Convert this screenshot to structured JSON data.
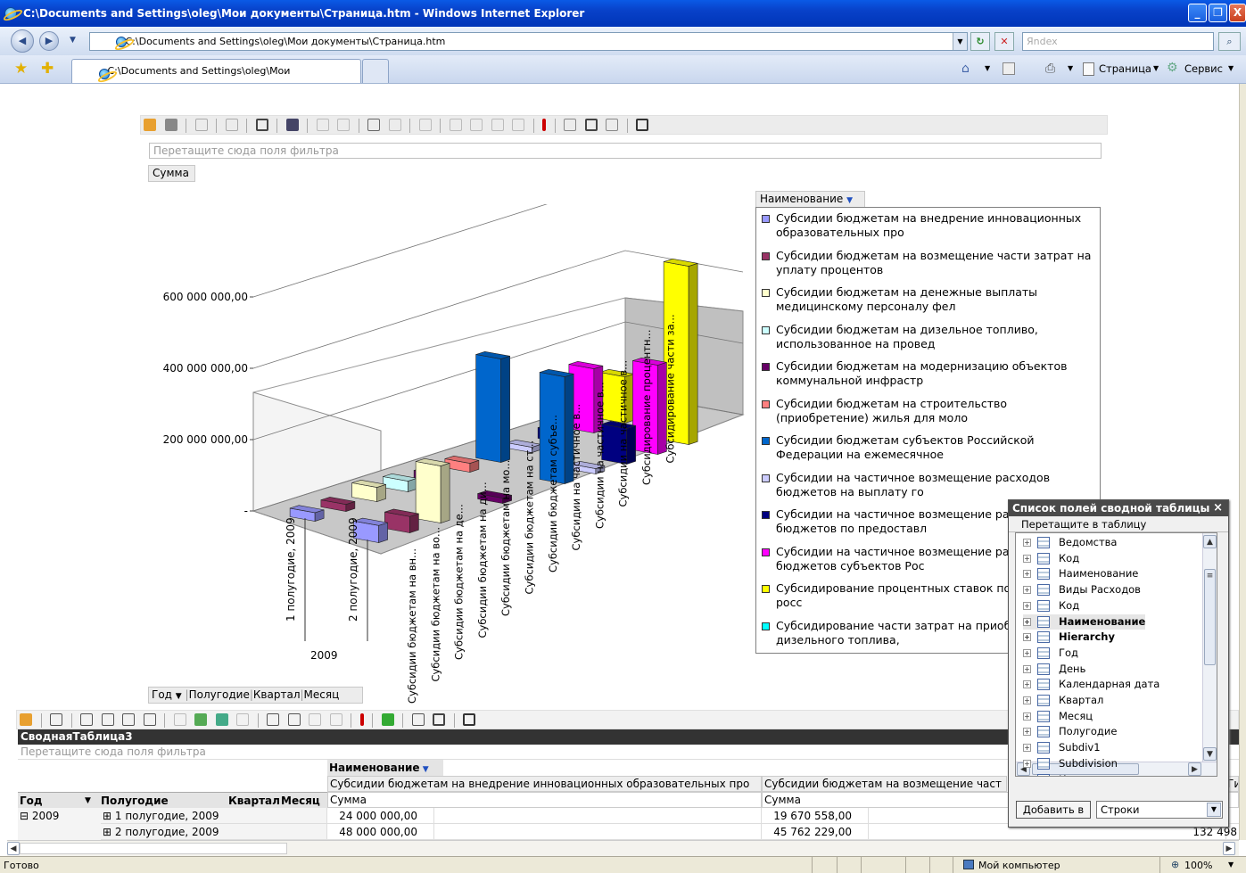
{
  "window": {
    "title": "C:\\Documents and Settings\\oleg\\Мои документы\\Страница.htm - Windows Internet Explorer",
    "minimize": "_",
    "maximize": "❐",
    "close": "X"
  },
  "browser": {
    "address": "C:\\Documents and Settings\\oleg\\Мои документы\\Страница.htm",
    "search_placeholder": "Яndex",
    "tab_label": "C:\\Documents and Settings\\oleg\\Мои документы\\Ст...",
    "page_menu": "Страница",
    "tools_menu": "Сервис"
  },
  "chart_toolbar": {
    "filter_drop_hint": "Перетащите сюда поля фильтра",
    "data_field": "Сумма",
    "series_field": "Наименование",
    "category_fields": [
      "Год",
      "Полугодие",
      "Квартал",
      "Месяц"
    ]
  },
  "chart_data": {
    "type": "bar",
    "ylim": [
      0,
      700000000
    ],
    "y_ticks": [
      "600 000 000,00",
      "400 000 000,00",
      "200 000 000,00",
      "-"
    ],
    "x_tick_labels": [
      "1 полугодие, 2009",
      "2 полугодие, 2009"
    ],
    "x_group_label": "2009",
    "depth_labels": [
      "Субсидии бюджетам на вн...",
      "Субсидии бюджетам на во...",
      "Субсидии бюджетам на де...",
      "Субсидии бюджетам на ди...",
      "Субсидии бюджетам на мо...",
      "Субсидии бюджетам на ст...",
      "Субсидии бюджетам субъе...",
      "Субсидии на частичное в...",
      "Субсидии на частичное в...",
      "Субсидии на частичное в...",
      "Субсидирование процентн...",
      "Субсидирование части за..."
    ],
    "categories": [
      "1 полугодие, 2009",
      "2 полугодие, 2009"
    ],
    "series": [
      {
        "name": "Субсидии бюджетам на внедрение инновационных образовательных про",
        "color": "#9999ff",
        "values": [
          24000000,
          48000000
        ]
      },
      {
        "name": "Субсидии бюджетам на возмещение части затрат на уплату процентов",
        "color": "#993366",
        "values": [
          19670558,
          45762229
        ]
      },
      {
        "name": "Субсидии бюджетам на денежные выплаты медицинскому персоналу фел",
        "color": "#ffffcc",
        "values": [
          40000000,
          160000000
        ]
      },
      {
        "name": "Субсидии бюджетам на дизельное топливо, использованное на провед",
        "color": "#ccffff",
        "values": [
          30000000,
          0
        ]
      },
      {
        "name": "Субсидии бюджетам на модернизацию объектов коммунальной инфрастр",
        "color": "#660066",
        "values": [
          20000000,
          15000000
        ]
      },
      {
        "name": "Субсидии бюджетам на строительство (приобретение) жилья для моло",
        "color": "#ff8080",
        "values": [
          25000000,
          0
        ]
      },
      {
        "name": "Субсидии бюджетам субъектов Российской Федерации на ежемесячное",
        "color": "#0066cc",
        "values": [
          290000000,
          300000000
        ]
      },
      {
        "name": "Субсидии на частичное возмещение расходов бюджетов на выплату го",
        "color": "#ccccff",
        "values": [
          15000000,
          15000000
        ]
      },
      {
        "name": "Субсидии на частичное возмещение расходов бюджетов по предоставл",
        "color": "#000080",
        "values": [
          30000000,
          100000000
        ]
      },
      {
        "name": "Субсидии на частичное возмещение расходов бюджетов субъектов Рос",
        "color": "#ff00ff",
        "values": [
          180000000,
          250000000
        ]
      },
      {
        "name": "Субсидирование процентных ставок по кредитам в росс",
        "color": "#ffff00",
        "values": [
          130000000,
          500000000
        ]
      },
      {
        "name": "Субсидирование части затрат на приобретение дизельного топлива,",
        "color": "#00ffff",
        "values": [
          40000000,
          0
        ]
      }
    ]
  },
  "field_list": {
    "title": "Список полей сводной таблицы",
    "close": "×",
    "hint": "Перетащите в таблицу",
    "items": [
      {
        "label": "Ведомства",
        "bold": false
      },
      {
        "label": "Код",
        "bold": false
      },
      {
        "label": "Наименование",
        "bold": false
      },
      {
        "label": "Виды Расходов",
        "bold": false
      },
      {
        "label": "Код",
        "bold": false
      },
      {
        "label": "Наименование",
        "bold": true
      },
      {
        "label": "Hierarchy",
        "bold": true
      },
      {
        "label": "Год",
        "bold": false
      },
      {
        "label": "День",
        "bold": false
      },
      {
        "label": "Календарная дата",
        "bold": false
      },
      {
        "label": "Квартал",
        "bold": false
      },
      {
        "label": "Месяц",
        "bold": false
      },
      {
        "label": "Полугодие",
        "bold": false
      },
      {
        "label": "Subdiv1",
        "bold": false
      },
      {
        "label": "Subdivision",
        "bold": false
      },
      {
        "label": "Код",
        "bold": false
      }
    ],
    "add_button": "Добавить в",
    "add_target": "Строки"
  },
  "pivot": {
    "title": "СводнаяТаблица3",
    "filter_hint": "Перетащите сюда поля фильтра",
    "column_field": "Наименование",
    "col1_header": "Субсидии бюджетам на внедрение инновационных образовательных про",
    "col2_header": "Субсидии бюджетам на возмещение част",
    "col3_header": "Ги",
    "measure": "Сумма",
    "row_fields": [
      "Год",
      "Полугодие",
      "Квартал",
      "Месяц"
    ],
    "year": "⊟ 2009",
    "rows": [
      {
        "label": "⊞ 1 полугодие, 2009",
        "c1": "24 000 000,00",
        "c2": "19 670 558,00",
        "c3": ""
      },
      {
        "label": "⊞ 2 полугодие, 2009",
        "c1": "48 000 000,00",
        "c2": "45 762 229,00",
        "c3": "132 498"
      }
    ]
  },
  "status": {
    "left": "Готово",
    "zone": "Мой компьютер",
    "zoom": "100%"
  }
}
